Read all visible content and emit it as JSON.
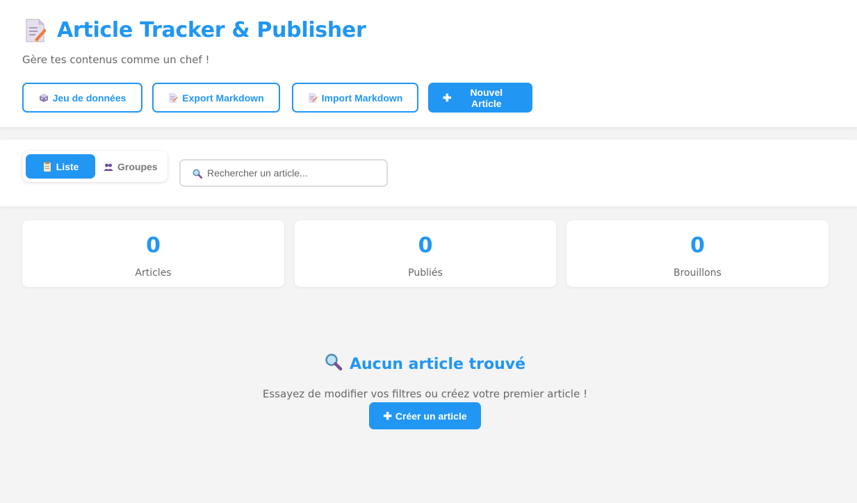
{
  "header": {
    "title": "Article Tracker & Publisher",
    "subtitle": "Gère tes contenus comme un chef !",
    "actions": {
      "dataset_label": "Jeu de données",
      "export_label": "Export Markdown",
      "import_label": "Import Markdown",
      "new_article_label": "Nouvel Article"
    }
  },
  "toolbar": {
    "view_list_label": "Liste",
    "view_groups_label": "Groupes",
    "search_placeholder": "Rechercher un article..."
  },
  "stats": [
    {
      "value": "0",
      "label": "Articles"
    },
    {
      "value": "0",
      "label": "Publiés"
    },
    {
      "value": "0",
      "label": "Brouillons"
    }
  ],
  "empty_state": {
    "title": "Aucun article trouvé",
    "message": "Essayez de modifier vos filtres ou créez votre premier article !",
    "create_label": "Créer un article"
  },
  "colors": {
    "accent": "#2196f3",
    "background": "#f4f4f4"
  },
  "icons": {
    "title": "memo-icon",
    "dataset": "dice-icon",
    "export": "memo-icon",
    "import": "memo-icon",
    "add": "plus-icon",
    "list": "clipboard-icon",
    "groups": "people-icon",
    "search": "magnifier-icon"
  }
}
